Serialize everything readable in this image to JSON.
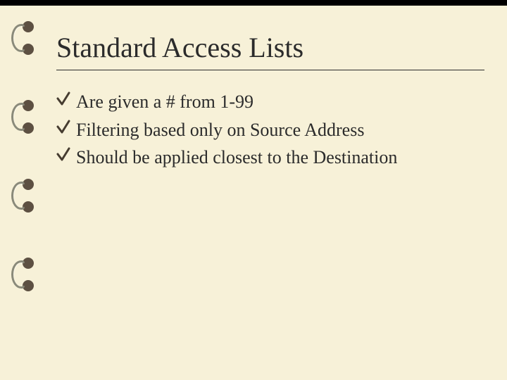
{
  "slide": {
    "title": "Standard Access Lists",
    "bullets": [
      "Are given a # from 1-99",
      "Filtering based only on Source Address",
      "Should be applied closest to the Destination"
    ]
  }
}
